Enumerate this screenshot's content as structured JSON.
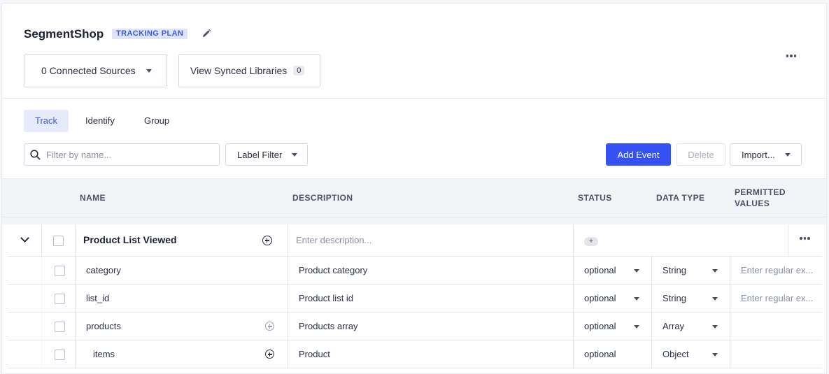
{
  "header": {
    "title": "SegmentShop",
    "badge": "TRACKING PLAN",
    "connected_sources": "0 Connected Sources",
    "synced_libraries": "View Synced Libraries",
    "synced_count": "0"
  },
  "tabs": [
    {
      "label": "Track",
      "active": true
    },
    {
      "label": "Identify",
      "active": false
    },
    {
      "label": "Group",
      "active": false
    }
  ],
  "toolbar": {
    "search_placeholder": "Filter by name...",
    "label_filter": "Label Filter",
    "add_event": "Add Event",
    "delete": "Delete",
    "import": "Import..."
  },
  "table": {
    "columns": {
      "name": "NAME",
      "description": "DESCRIPTION",
      "status": "STATUS",
      "data_type": "DATA TYPE",
      "permitted_values_line1": "PERMITTED",
      "permitted_values_line2": "VALUES"
    },
    "event": {
      "name": "Product List Viewed",
      "description_placeholder": "Enter description...",
      "status_add": "+"
    },
    "properties": [
      {
        "name": "category",
        "description": "Product category",
        "status": "optional",
        "data_type": "String",
        "permitted": "Enter regular ex..."
      },
      {
        "name": "list_id",
        "description": "Product list id",
        "status": "optional",
        "data_type": "String",
        "permitted": "Enter regular ex..."
      },
      {
        "name": "products",
        "description": "Products array",
        "status": "optional",
        "data_type": "Array",
        "permitted": ""
      },
      {
        "name": "items",
        "description": "Product",
        "status": "optional",
        "data_type": "Object",
        "permitted": ""
      }
    ]
  },
  "colors": {
    "accent": "#3550f3",
    "badge_bg": "#dde4fb",
    "badge_text": "#3c5ad8"
  }
}
